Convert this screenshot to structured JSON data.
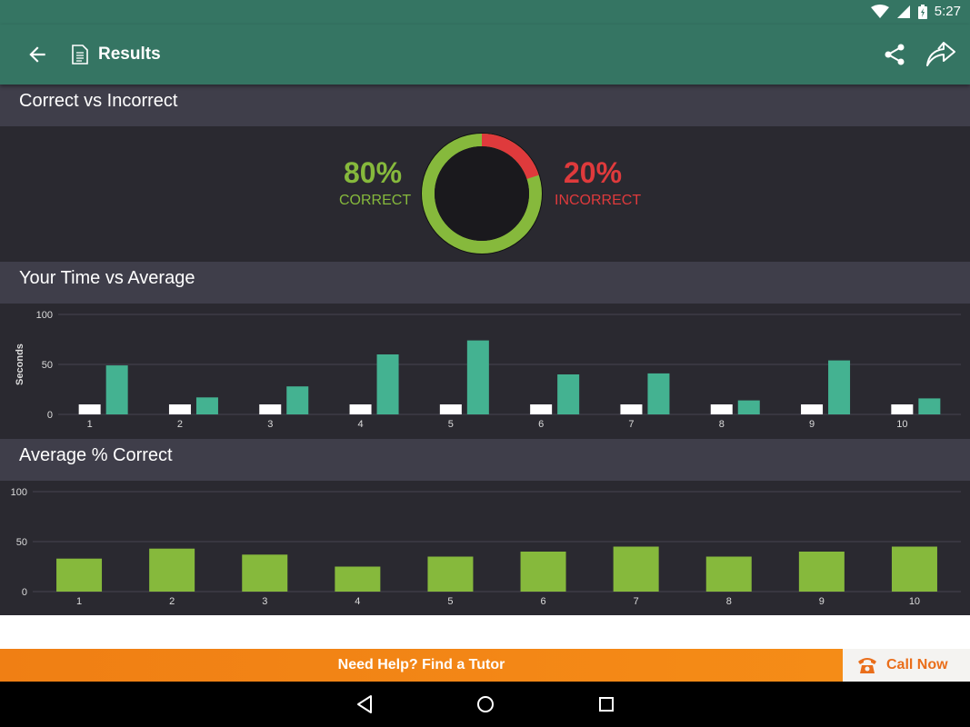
{
  "status_bar": {
    "time": "5:27",
    "icons": [
      "wifi-icon",
      "signal-icon",
      "battery-charging-icon"
    ]
  },
  "app_bar": {
    "title": "Results",
    "icons": [
      "back-arrow-icon",
      "document-icon",
      "share-icon",
      "forward-icon"
    ]
  },
  "sections": {
    "correct_vs_incorrect": "Correct vs Incorrect",
    "time_vs_average": "Your Time vs Average",
    "average_correct": "Average % Correct"
  },
  "score": {
    "correct_pct": "80%",
    "correct_label": "CORRECT",
    "incorrect_pct": "20%",
    "incorrect_label": "INCORRECT",
    "correct_fraction": 0.8,
    "colors": {
      "correct": "#86b93c",
      "incorrect": "#df3a3c"
    }
  },
  "chart_data": [
    {
      "type": "bar",
      "categories": [
        "1",
        "2",
        "3",
        "4",
        "5",
        "6",
        "7",
        "8",
        "9",
        "10"
      ],
      "ylabel": "Seconds",
      "ylim": [
        0,
        100
      ],
      "yticks": [
        "0",
        "50",
        "100"
      ],
      "series": [
        {
          "values": [
            10,
            10,
            10,
            10,
            10,
            10,
            10,
            10,
            10,
            10
          ],
          "color": "#ffffff"
        },
        {
          "values": [
            49,
            17,
            28,
            60,
            74,
            40,
            41,
            14,
            54,
            16
          ],
          "color": "#44b291"
        }
      ],
      "grid": true
    },
    {
      "type": "bar",
      "categories": [
        "1",
        "2",
        "3",
        "4",
        "5",
        "6",
        "7",
        "8",
        "9",
        "10"
      ],
      "ylim": [
        0,
        100
      ],
      "yticks": [
        "0",
        "50",
        "100"
      ],
      "series": [
        {
          "values": [
            33,
            43,
            37,
            25,
            35,
            40,
            45,
            35,
            40,
            45
          ],
          "color": "#86b93c"
        }
      ],
      "grid": true
    }
  ],
  "footer": {
    "tutor_label": "Need Help? Find a Tutor",
    "call_label": "Call Now"
  },
  "nav": {
    "icons": [
      "back-triangle-icon",
      "home-circle-icon",
      "recents-square-icon"
    ]
  }
}
